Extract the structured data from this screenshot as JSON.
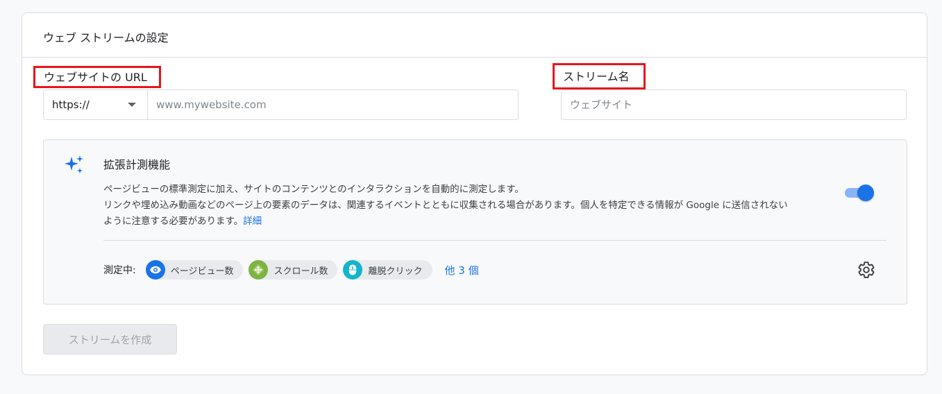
{
  "card": {
    "title": "ウェブ ストリームの設定"
  },
  "url_section": {
    "label": "ウェブサイトの URL",
    "protocol": "https://",
    "placeholder": "www.mywebsite.com"
  },
  "name_section": {
    "label": "ストリーム名",
    "placeholder": "ウェブサイト"
  },
  "enhanced": {
    "title": "拡張計測機能",
    "desc_line1": "ページビューの標準測定に加え、サイトのコンテンツとのインタラクションを自動的に測定します。",
    "desc_line2": "リンクや埋め込み動画などのページ上の要素のデータは、関連するイベントとともに収集される場合があります。個人を特定できる情報が Google に送信されない",
    "desc_line3": "ように注意する必要があります。",
    "details_link": "詳細",
    "toggle_on": true,
    "measuring_label": "測定中:",
    "chips": [
      {
        "label": "ページビュー数",
        "icon": "eye-icon",
        "color": "#1a73e8"
      },
      {
        "label": "スクロール数",
        "icon": "scroll-icon",
        "color": "#7cb342"
      },
      {
        "label": "離脱クリック",
        "icon": "mouse-icon",
        "color": "#12b5cb"
      }
    ],
    "more_link": "他 3 個"
  },
  "create_button": "ストリームを作成",
  "colors": {
    "accent": "#1a73e8",
    "highlight_border": "#e8141b"
  }
}
